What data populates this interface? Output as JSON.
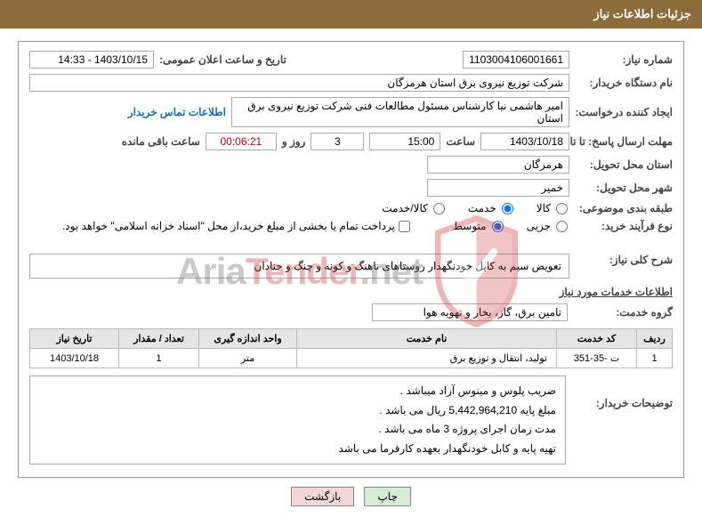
{
  "header": {
    "title": "جزئیات اطلاعات نیاز"
  },
  "fields": {
    "need_no_label": "شماره نیاز:",
    "need_no": "1103004106001661",
    "announce_label": "تاریخ و ساعت اعلان عمومی:",
    "announce_value": "1403/10/15 - 14:33",
    "buyer_label": "نام دستگاه خریدار:",
    "buyer_value": "شرکت توزیع نیروی برق استان هرمزگان",
    "creator_label": "ایجاد کننده درخواست:",
    "creator_value": "امیر هاشمی نیا کارشناس مسئول مطالعات فنی شرکت توزیع نیروی برق استان",
    "contact_link": "اطلاعات تماس خریدار",
    "deadline_label": "مهلت ارسال پاسخ: تا تاریخ:",
    "deadline_date": "1403/10/18",
    "time_label": "ساعت",
    "deadline_time": "15:00",
    "days_value": "3",
    "days_text": "روز و",
    "countdown": "00:06:21",
    "remain_text": "ساعت باقی مانده",
    "province_label": "استان محل تحویل:",
    "province_value": "هرمزگان",
    "city_label": "شهر محل تحویل:",
    "city_value": "خمیر",
    "category_label": "طبقه بندی موضوعی:",
    "cat_goods": "کالا",
    "cat_service": "خدمت",
    "cat_both": "کالا/خدمت",
    "process_label": "نوع فرآیند خرید:",
    "proc_minor": "جزیی",
    "proc_medium": "متوسط",
    "treasury_note": "پرداخت تمام یا بخشی از مبلغ خرید،از محل \"اسناد خزانه اسلامی\" خواهد بود."
  },
  "need_summary": {
    "label": "شرح کلی نیاز:",
    "text": "تعویض سیم به کابل خودنگهدار روستاهای ناهنگ و کونه و چنگ و حنادان"
  },
  "services_title": "اطلاعات خدمات مورد نیاز",
  "service_group": {
    "label": "گروه خدمت:",
    "value": "تامین برق، گاز، بخار و تهویه هوا"
  },
  "table": {
    "headers": [
      "ردیف",
      "کد خدمت",
      "نام خدمت",
      "واحد اندازه گیری",
      "تعداد / مقدار",
      "تاریخ نیاز"
    ],
    "rows": [
      {
        "idx": "1",
        "code": "ت -35-351",
        "name": "تولید، انتقال و توزیع برق",
        "unit": "متر",
        "qty": "1",
        "date": "1403/10/18"
      }
    ]
  },
  "buyer_notes": {
    "label": "توضیحات خریدار:",
    "lines": [
      "ضریب پلوس و مینوس آزاد میباشد .",
      "مبلغ پایه 5,442,964,210 ریال می باشد .",
      "مدت زمان اجرای پروژه 3 ماه می باشد .",
      "تهیه پایه و کابل خودنگهدار بعهده کارفرما می باشد"
    ]
  },
  "buttons": {
    "print": "چاپ",
    "back": "بازگشت"
  },
  "watermark": {
    "text_a": "Aria",
    "text_b": "Tender",
    "text_c": ".net"
  }
}
